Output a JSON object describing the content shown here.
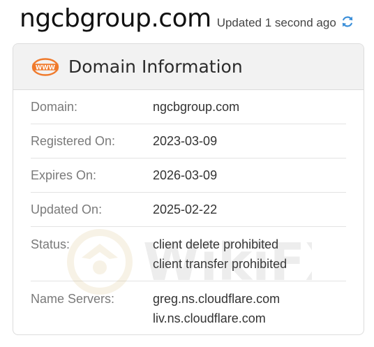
{
  "header": {
    "domain": "ngcbgroup.com",
    "updated": "Updated 1 second ago"
  },
  "card": {
    "title": "Domain Information",
    "icon_text": "WWW"
  },
  "rows": [
    {
      "label": "Domain:",
      "values": [
        "ngcbgroup.com"
      ]
    },
    {
      "label": "Registered On:",
      "values": [
        "2023-03-09"
      ]
    },
    {
      "label": "Expires On:",
      "values": [
        "2026-03-09"
      ]
    },
    {
      "label": "Updated On:",
      "values": [
        "2025-02-22"
      ]
    },
    {
      "label": "Status:",
      "values": [
        "client delete prohibited",
        "client transfer prohibited"
      ]
    },
    {
      "label": "Name Servers:",
      "values": [
        "greg.ns.cloudflare.com",
        "liv.ns.cloudflare.com"
      ]
    }
  ],
  "watermark": "WikiFX",
  "colors": {
    "accent_orange": "#f07a2c",
    "refresh_blue": "#3b8fd9"
  }
}
